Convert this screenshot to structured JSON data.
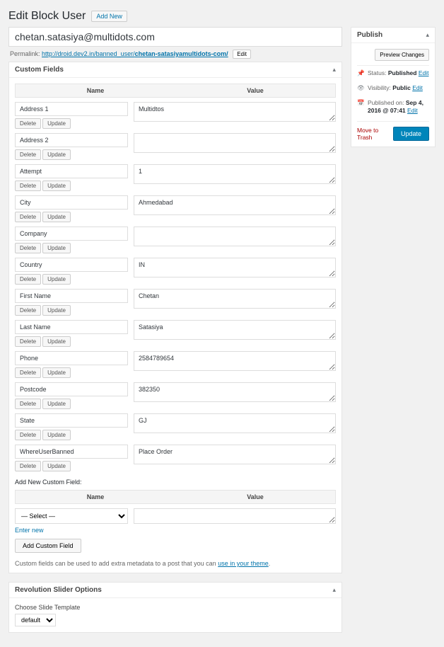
{
  "header": {
    "title": "Edit Block User",
    "add_new": "Add New"
  },
  "post": {
    "title": "chetan.satasiya@multidots.com",
    "permalink_label": "Permalink:",
    "permalink_base": "http://droid.dev2.in/banned_user/",
    "permalink_slug": "chetan-satasiyamultidots-com/",
    "edit_slug": "Edit"
  },
  "custom_fields": {
    "panel_title": "Custom Fields",
    "col_name": "Name",
    "col_value": "Value",
    "delete": "Delete",
    "update": "Update",
    "rows": [
      {
        "name": "Address 1",
        "value": "Multidtos"
      },
      {
        "name": "Address 2",
        "value": ""
      },
      {
        "name": "Attempt",
        "value": "1"
      },
      {
        "name": "City",
        "value": "Ahmedabad"
      },
      {
        "name": "Company",
        "value": ""
      },
      {
        "name": "Country",
        "value": "IN"
      },
      {
        "name": "First Name",
        "value": "Chetan"
      },
      {
        "name": "Last Name",
        "value": "Satasiya"
      },
      {
        "name": "Phone",
        "value": "2584789654"
      },
      {
        "name": "Postcode",
        "value": "382350"
      },
      {
        "name": "State",
        "value": "GJ"
      },
      {
        "name": "WhereUserBanned",
        "value": "Place Order"
      }
    ],
    "add_new_label": "Add New Custom Field:",
    "select_placeholder": "— Select —",
    "enter_new": "Enter new",
    "add_button": "Add Custom Field",
    "help_text": "Custom fields can be used to add extra metadata to a post that you can ",
    "help_link": "use in your theme"
  },
  "rev_slider": {
    "panel_title": "Revolution Slider Options",
    "label": "Choose Slide Template",
    "value": "default"
  },
  "publish": {
    "panel_title": "Publish",
    "preview": "Preview Changes",
    "status_label": "Status:",
    "status_value": "Published",
    "visibility_label": "Visibility:",
    "visibility_value": "Public",
    "published_label": "Published on:",
    "published_value": "Sep 4, 2016 @ 07:41",
    "edit": "Edit",
    "trash": "Move to Trash",
    "update": "Update"
  }
}
